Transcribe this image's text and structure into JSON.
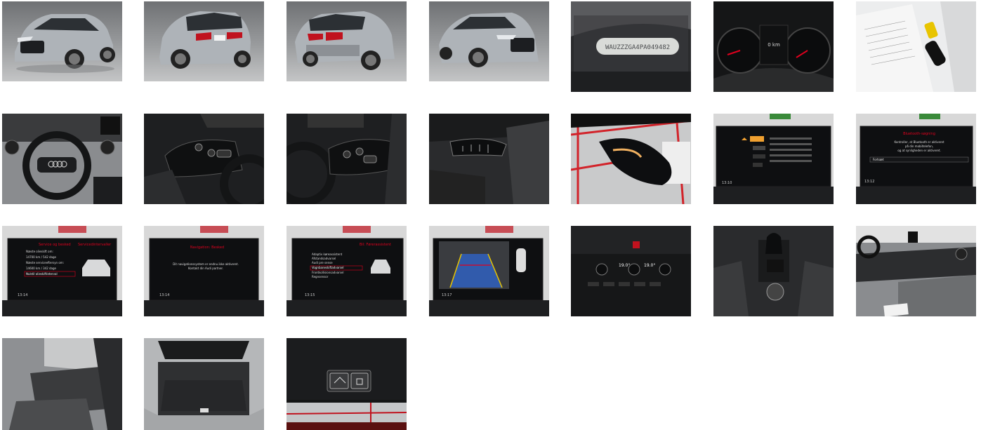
{
  "gallery": {
    "vin_plate": "WAUZZZGA4PA049482",
    "screen_service": {
      "title": "Service og besked",
      "title_right": "Servicedintervaller",
      "rows": [
        "Næste olieskift om:",
        "14700 km / 542 dage",
        "Næste serviceeftersyn om:",
        "14600 km / 342 dage",
        "Nulstil olieskiftinterval"
      ],
      "clock": "13:14"
    },
    "screen_nav": {
      "title": "Navigation: Besked",
      "line1": "Dit navigationssystem er endnu ikke aktiveret.",
      "line2": "Kontakt din Audi partner.",
      "clock": "13:14"
    },
    "screen_assist": {
      "title": "Bil: Førerassistent",
      "rows": [
        "Adaptiv køreassistent",
        "Afstandsadvarsel",
        "Audi pre sense",
        "Vognbaneskiftadvarsel",
        "Frontkollisionsadvarsel",
        "Regnsensor"
      ],
      "clock": "13:15"
    },
    "screen_bt": {
      "title": "Bluetooth-søgning",
      "line1": "Kontroller, at Bluetooth er aktiveret",
      "line2": "på din mobiltelefon,",
      "line3": "og at synligheden er aktiveret.",
      "button": "Fortsæt",
      "clock": "13:12"
    },
    "screen_media": {
      "clock": "13:10"
    },
    "screen_camera": {
      "clock": "13:17"
    },
    "climate": {
      "left_temp": "19.0°",
      "right_temp": "19.0°"
    },
    "cluster": {
      "odometer": "0 km"
    }
  },
  "colors": {
    "accent_red": "#e1001e",
    "car_silver": "#aeb3b8",
    "studio_grey": "#8e9194",
    "interior_dark": "#1c1d1f"
  }
}
